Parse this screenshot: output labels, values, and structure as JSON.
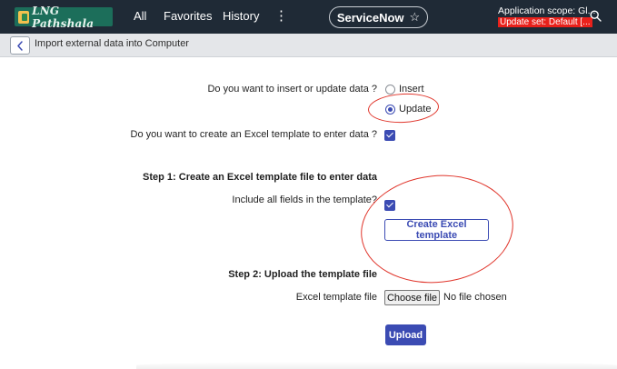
{
  "header": {
    "logo_text": "LNG Pathshala",
    "nav": [
      "All",
      "Favorites",
      "History"
    ],
    "more_icon": "vertical-ellipsis-icon",
    "pill_label": "ServiceNow",
    "star_icon": "star-outline-icon",
    "scope_text": "Application scope: Gl...",
    "update_set_text": "Update set: Default [...",
    "update_set_color": "#e8211b",
    "search_icon": "search-icon"
  },
  "subheader": {
    "back_icon": "chevron-left-icon",
    "title": "Import external data into Computer"
  },
  "form": {
    "q_insert_update": "Do you want to insert or update data ?",
    "option_insert": "Insert",
    "option_update": "Update",
    "selected": "Update",
    "q_template": "Do you want to create an Excel template to enter data ?",
    "template_checked": true,
    "step1_label": "Step   1:  Create an Excel template file to enter data",
    "include_fields_label": "Include all fields in the template?",
    "include_fields_checked": true,
    "create_button": "Create Excel template",
    "step2_label": "Step   2:   Upload the template file",
    "file_label": "Excel template file",
    "choose_file": "Choose file",
    "no_file": "No file chosen",
    "upload_button": "Upload"
  },
  "colors": {
    "topbar": "#1f2a36",
    "accent": "#3b4bb3",
    "annotation": "#e0352b"
  }
}
